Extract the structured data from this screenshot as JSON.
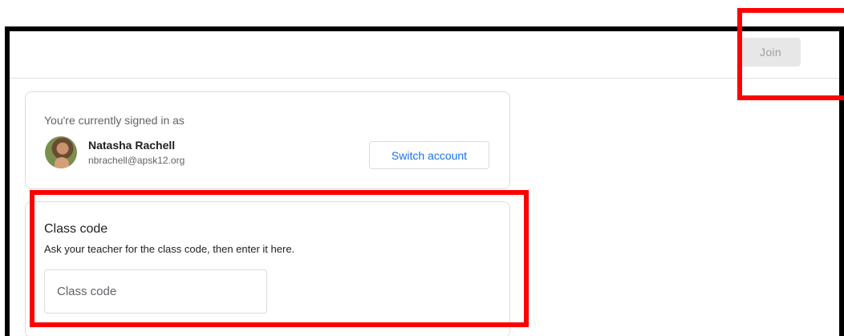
{
  "header": {
    "join_label": "Join"
  },
  "account": {
    "signed_in_label": "You're currently signed in as",
    "name": "Natasha Rachell",
    "email": "nbrachell@apsk12.org",
    "switch_label": "Switch account"
  },
  "class_code": {
    "title": "Class code",
    "description": "Ask your teacher for the class code, then enter it here.",
    "placeholder": "Class code",
    "value": ""
  },
  "annotations": {
    "highlight_color": "#ff0000"
  },
  "colors": {
    "link_blue": "#1a73e8",
    "disabled_button_bg": "#e7e7e7",
    "border": "#dadce0"
  }
}
